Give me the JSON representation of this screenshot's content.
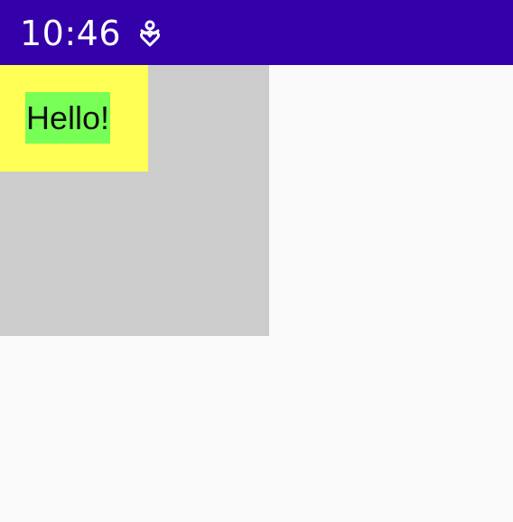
{
  "status_bar": {
    "time": "10:46",
    "notification_icon": "accessibility-heart-icon",
    "background_color": "#3300aa"
  },
  "main": {
    "text": "Hello!",
    "colors": {
      "outer_box": "#cccccc",
      "inner_box": "#ffff55",
      "text_highlight": "#77ff55",
      "page_background": "#fafafa"
    }
  }
}
